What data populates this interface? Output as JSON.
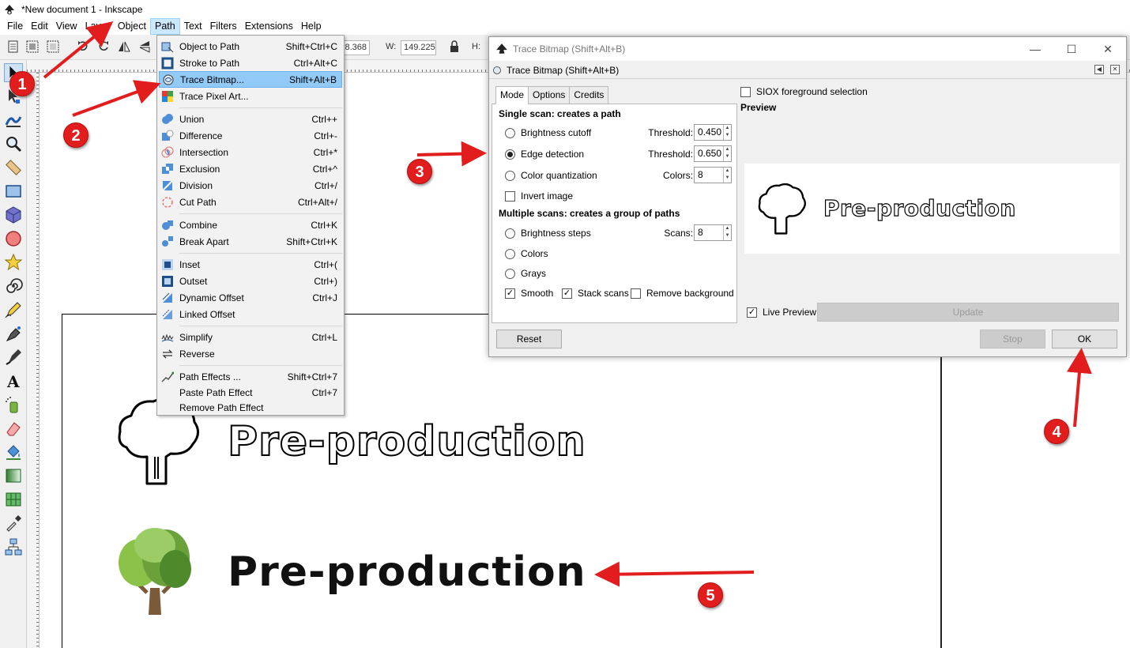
{
  "window": {
    "title": "*New document 1 - Inkscape"
  },
  "menubar": {
    "items": [
      "File",
      "Edit",
      "View",
      "Layer",
      "Object",
      "Path",
      "Text",
      "Filters",
      "Extensions",
      "Help"
    ],
    "active": "Path"
  },
  "toolbar": {
    "x_value": "18.368",
    "w_label": "W:",
    "w_value": "149.225",
    "h_label": "H:"
  },
  "path_menu": {
    "items": [
      {
        "label": "Object to Path",
        "shortcut": "Shift+Ctrl+C",
        "icon": "object-to-path-icon"
      },
      {
        "label": "Stroke to Path",
        "shortcut": "Ctrl+Alt+C",
        "icon": "stroke-to-path-icon"
      },
      {
        "label": "Trace Bitmap...",
        "shortcut": "Shift+Alt+B",
        "icon": "trace-bitmap-icon",
        "highlighted": true
      },
      {
        "label": "Trace Pixel Art...",
        "shortcut": "",
        "icon": "trace-pixel-art-icon"
      },
      {
        "label": "Union",
        "shortcut": "Ctrl++",
        "icon": "union-icon"
      },
      {
        "label": "Difference",
        "shortcut": "Ctrl+-",
        "icon": "difference-icon"
      },
      {
        "label": "Intersection",
        "shortcut": "Ctrl+*",
        "icon": "intersection-icon"
      },
      {
        "label": "Exclusion",
        "shortcut": "Ctrl+^",
        "icon": "exclusion-icon"
      },
      {
        "label": "Division",
        "shortcut": "Ctrl+/",
        "icon": "division-icon"
      },
      {
        "label": "Cut Path",
        "shortcut": "Ctrl+Alt+/",
        "icon": "cut-path-icon"
      },
      {
        "label": "Combine",
        "shortcut": "Ctrl+K",
        "icon": "combine-icon"
      },
      {
        "label": "Break Apart",
        "shortcut": "Shift+Ctrl+K",
        "icon": "break-apart-icon"
      },
      {
        "label": "Inset",
        "shortcut": "Ctrl+(",
        "icon": "inset-icon"
      },
      {
        "label": "Outset",
        "shortcut": "Ctrl+)",
        "icon": "outset-icon"
      },
      {
        "label": "Dynamic Offset",
        "shortcut": "Ctrl+J",
        "icon": "dynamic-offset-icon"
      },
      {
        "label": "Linked Offset",
        "shortcut": "",
        "icon": "linked-offset-icon"
      },
      {
        "label": "Simplify",
        "shortcut": "Ctrl+L",
        "icon": "simplify-icon"
      },
      {
        "label": "Reverse",
        "shortcut": "",
        "icon": "reverse-icon"
      },
      {
        "label": "Path Effects ...",
        "shortcut": "Shift+Ctrl+7",
        "icon": "path-effects-icon"
      },
      {
        "label": "Paste Path Effect",
        "shortcut": "Ctrl+7",
        "icon": ""
      },
      {
        "label": "Remove Path Effect",
        "shortcut": "",
        "icon": ""
      }
    ]
  },
  "dialog": {
    "window_title": "Trace Bitmap (Shift+Alt+B)",
    "panel_title": "Trace Bitmap (Shift+Alt+B)",
    "tabs": [
      "Mode",
      "Options",
      "Credits"
    ],
    "active_tab": "Mode",
    "single_scan_title": "Single scan: creates a path",
    "brightness_cutoff": {
      "label": "Brightness cutoff",
      "param_label": "Threshold:",
      "value": "0.450",
      "selected": false
    },
    "edge_detection": {
      "label": "Edge detection",
      "param_label": "Threshold:",
      "value": "0.650",
      "selected": true
    },
    "color_quantization": {
      "label": "Color quantization",
      "param_label": "Colors:",
      "value": "8",
      "selected": false
    },
    "invert_image": {
      "label": "Invert image",
      "checked": false
    },
    "multiple_scans_title": "Multiple scans: creates a group of paths",
    "brightness_steps": {
      "label": "Brightness steps",
      "param_label": "Scans:",
      "value": "8",
      "selected": false
    },
    "colors": {
      "label": "Colors",
      "selected": false
    },
    "grays": {
      "label": "Grays",
      "selected": false
    },
    "smooth": {
      "label": "Smooth",
      "checked": true
    },
    "stack_scans": {
      "label": "Stack scans",
      "checked": true
    },
    "remove_background": {
      "label": "Remove background",
      "checked": false
    },
    "siox": {
      "label": "SIOX foreground selection",
      "checked": false
    },
    "preview_title": "Preview",
    "preview_text": "Pre-production",
    "live_preview": {
      "label": "Live Preview",
      "checked": true
    },
    "update_label": "Update",
    "reset_label": "Reset",
    "stop_label": "Stop",
    "ok_label": "OK"
  },
  "canvas": {
    "outline_text": "Pre-production",
    "filled_text": "Pre-production"
  },
  "annotations": {
    "badges": [
      "1",
      "2",
      "3",
      "4",
      "5"
    ],
    "color": "#e21d1d"
  },
  "colors": {
    "menu_highlight": "#91c9f7",
    "tree_green_light": "#8bc34a",
    "tree_green_dark": "#4e8a2c",
    "tree_trunk": "#7b5a3a",
    "annotation_red": "#e21d1d"
  }
}
